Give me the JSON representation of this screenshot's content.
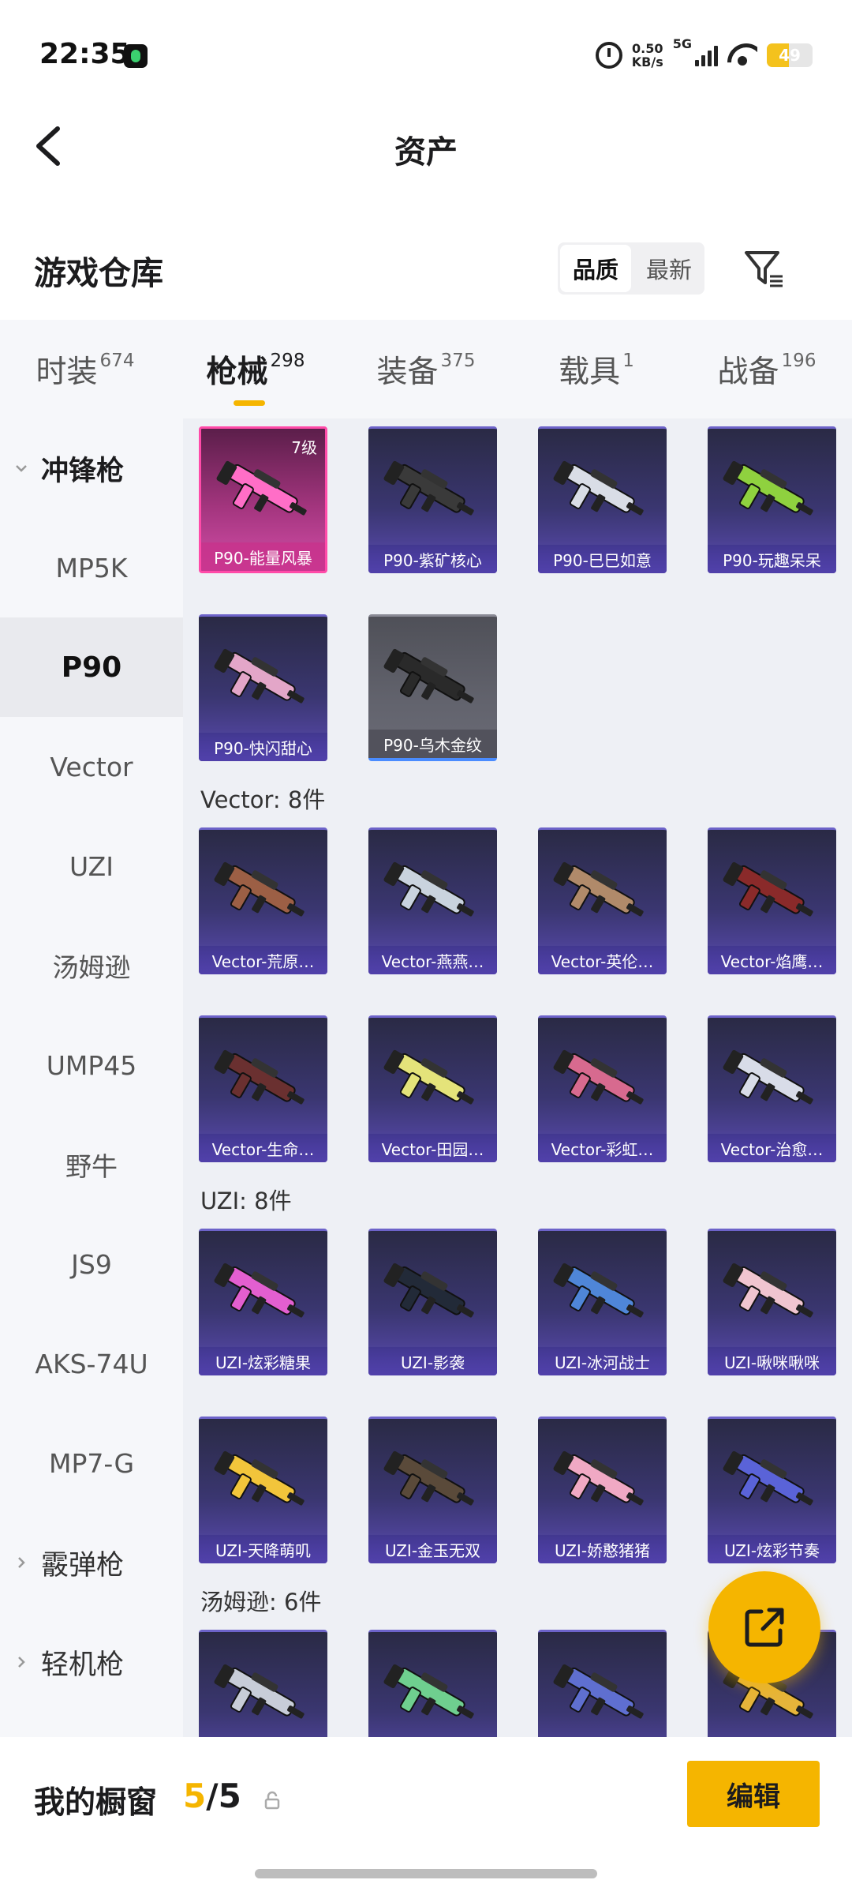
{
  "status_bar": {
    "time": "22:35",
    "net_speed_value": "0.50",
    "net_speed_unit": "KB/s",
    "network": "5G",
    "battery": "49"
  },
  "header": {
    "title": "资产"
  },
  "warehouse": {
    "title": "游戏仓库",
    "sort_options": [
      "品质",
      "最新"
    ],
    "active_sort": "品质"
  },
  "tabs": [
    {
      "label": "时装",
      "count": "674"
    },
    {
      "label": "枪械",
      "count": "298",
      "active": true
    },
    {
      "label": "装备",
      "count": "375"
    },
    {
      "label": "载具",
      "count": "1"
    },
    {
      "label": "战备",
      "count": "196"
    }
  ],
  "sidebar": [
    {
      "label": "冲锋枪",
      "type": "category",
      "expanded": true
    },
    {
      "label": "MP5K"
    },
    {
      "label": "P90",
      "selected": true
    },
    {
      "label": "Vector"
    },
    {
      "label": "UZI"
    },
    {
      "label": "汤姆逊"
    },
    {
      "label": "UMP45"
    },
    {
      "label": "野牛"
    },
    {
      "label": "JS9"
    },
    {
      "label": "AKS-74U"
    },
    {
      "label": "MP7-G"
    },
    {
      "label": "霰弹枪",
      "type": "category"
    },
    {
      "label": "轻机枪",
      "type": "category"
    }
  ],
  "weapons": {
    "p90": [
      {
        "name": "P90-能量风暴",
        "level": "7级",
        "style": "pink",
        "color": "#ff6ec7"
      },
      {
        "name": "P90-紫矿核心",
        "color": "#3a3a3a"
      },
      {
        "name": "P90-巳巳如意",
        "color": "#d9dde6"
      },
      {
        "name": "P90-玩趣呆呆",
        "color": "#8fd13f"
      },
      {
        "name": "P90-快闪甜心",
        "color": "#e3a6c8"
      },
      {
        "name": "P90-乌木金纹",
        "style": "gray",
        "color": "#2a2a2a"
      }
    ],
    "vector_label": "Vector: 8件",
    "vector": [
      {
        "name": "Vector-荒原…",
        "color": "#9c5f45"
      },
      {
        "name": "Vector-燕燕…",
        "color": "#c9d3de"
      },
      {
        "name": "Vector-英伦…",
        "color": "#b08a6a"
      },
      {
        "name": "Vector-焰鹰…",
        "color": "#8a2a2a"
      },
      {
        "name": "Vector-生命…",
        "color": "#6a3030"
      },
      {
        "name": "Vector-田园…",
        "color": "#e4e37a"
      },
      {
        "name": "Vector-彩虹…",
        "color": "#d76a8f"
      },
      {
        "name": "Vector-治愈…",
        "color": "#d8dce8"
      }
    ],
    "uzi_label": "UZI: 8件",
    "uzi": [
      {
        "name": "UZI-炫彩糖果",
        "color": "#e35fd0"
      },
      {
        "name": "UZI-影袭",
        "color": "#222a38"
      },
      {
        "name": "UZI-冰河战士",
        "color": "#4f86d8"
      },
      {
        "name": "UZI-啾咪啾咪",
        "color": "#f0c5d0"
      },
      {
        "name": "UZI-天降萌叽",
        "color": "#f2c53b"
      },
      {
        "name": "UZI-金玉无双",
        "color": "#5a4a3a"
      },
      {
        "name": "UZI-娇憨猪猪",
        "color": "#f0a9c4"
      },
      {
        "name": "UZI-炫彩节奏",
        "color": "#5a63d8"
      }
    ],
    "thompson_label": "汤姆逊: 6件",
    "thompson": [
      {
        "name": "",
        "color": "#c8cdd8"
      },
      {
        "name": "",
        "color": "#6fcf8f"
      },
      {
        "name": "",
        "color": "#5f6fd0"
      },
      {
        "name": "",
        "color": "#e6b43a"
      }
    ]
  },
  "bottom_bar": {
    "title": "我的橱窗",
    "count_current": "5",
    "count_separator": "/",
    "count_total": "5",
    "edit_label": "编辑"
  }
}
